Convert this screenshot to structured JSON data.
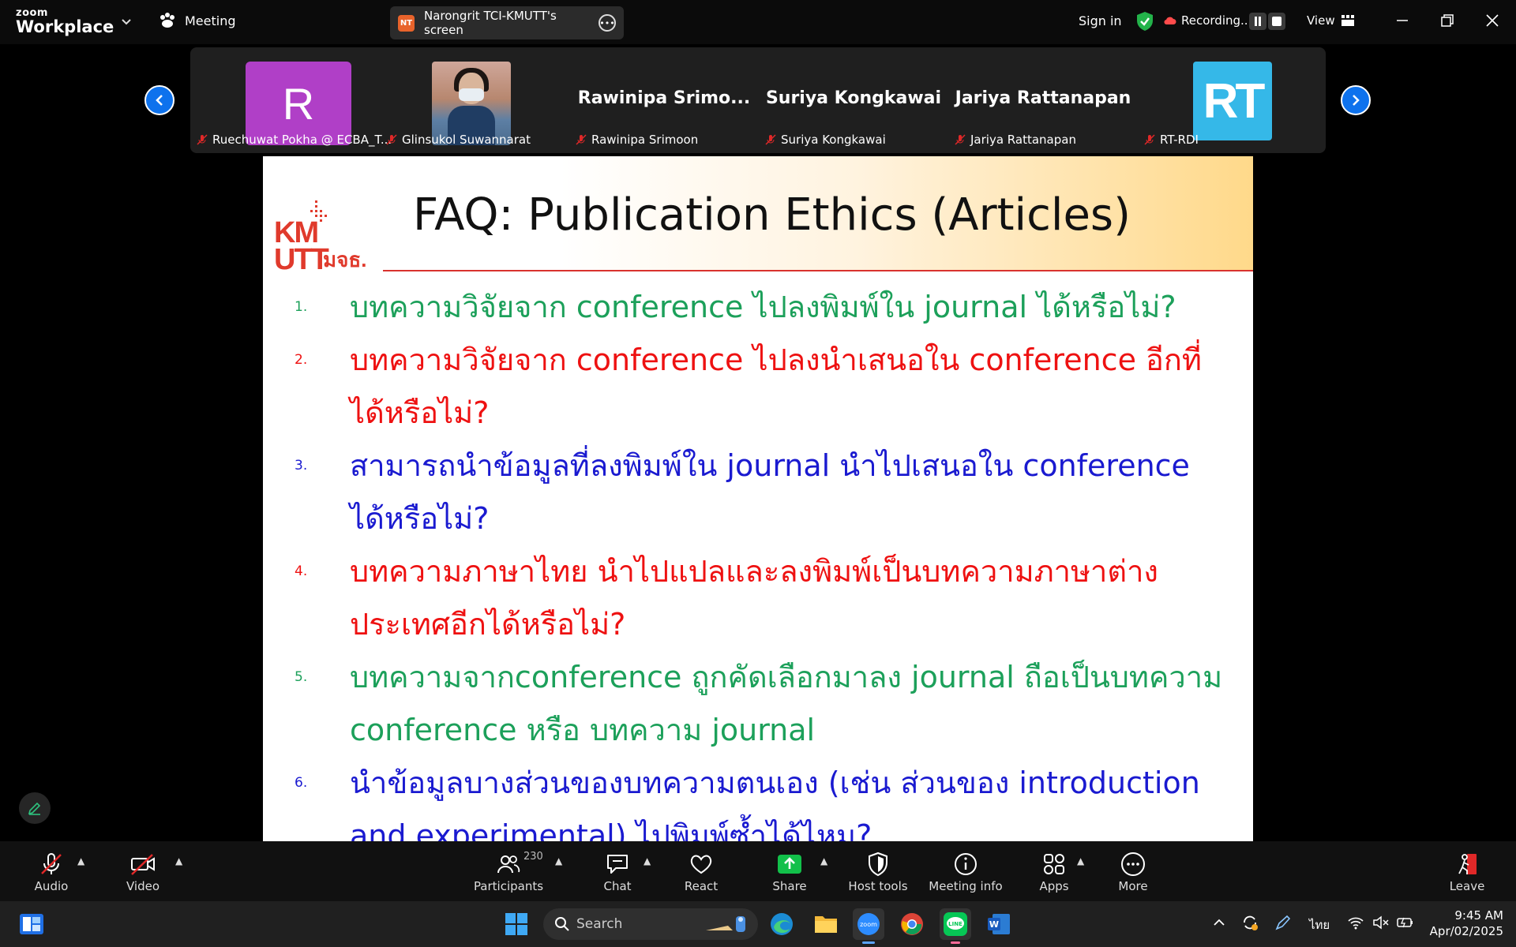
{
  "app": {
    "brand_small": "zoom",
    "brand_large": "Workplace"
  },
  "topbar": {
    "meeting_label": "Meeting",
    "screen_badge": "NT",
    "screen_label": "Narongrit TCI-KMUTT's screen",
    "sign_in": "Sign in",
    "recording": "Recording...",
    "view": "View"
  },
  "participants": [
    {
      "name": "Ruechuwat Pokha @ ECBA_T...",
      "avatar_letter": "R",
      "muted": true
    },
    {
      "name": "Glinsukol Suwannarat",
      "avatar": "photo",
      "muted": true
    },
    {
      "name": "Rawinipa Srimoon",
      "display_name": "Rawinipa  Srimo...",
      "muted": true
    },
    {
      "name": "Suriya Kongkawai",
      "display_name": "Suriya Kongkawai",
      "muted": true
    },
    {
      "name": "Jariya Rattanapan",
      "display_name": "Jariya Rattanapan",
      "muted": true
    },
    {
      "name": "RT-RDI",
      "avatar_text": "RT",
      "muted": true
    }
  ],
  "slide": {
    "title": "FAQ: Publication Ethics (Articles)",
    "logo_main": "KMUTT",
    "logo_thai": "มจธ.",
    "items": [
      {
        "num": "1.",
        "text": "บทความวิจัยจาก conference ไปลงพิมพ์ใน journal ได้หรือไม่?",
        "color": "#1ca05a"
      },
      {
        "num": "2.",
        "text": "บทความวิจัยจาก conference ไปลงนำเสนอใน conference อีกที่ได้หรือไม่?",
        "color": "#ee1111"
      },
      {
        "num": "3.",
        "text": "สามารถนำข้อมูลที่ลงพิมพ์ใน journal นำไปเสนอใน conference ได้หรือไม่?",
        "color": "#1a1ad0"
      },
      {
        "num": "4.",
        "text": "บทความภาษาไทย นำไปแปลและลงพิมพ์เป็นบทความภาษาต่างประเทศอีกได้หรือไม่?",
        "color": "#ee1111"
      },
      {
        "num": "5.",
        "text": "บทความจากconference ถูกคัดเลือกมาลง journal ถือเป็นบทความ conference หรือ บทความ journal",
        "color": "#1ca05a"
      },
      {
        "num": "6.",
        "text": "นำข้อมูลบางส่วนของบทความตนเอง (เช่น ส่วนของ introduction and experimental) ไปพิมพ์ซ้ำได้ไหม?",
        "color": "#1a1ad0"
      }
    ]
  },
  "toolbar": {
    "audio": "Audio",
    "video": "Video",
    "participants": "Participants",
    "participant_count": "230",
    "chat": "Chat",
    "react": "React",
    "share": "Share",
    "host_tools": "Host tools",
    "meeting_info": "Meeting info",
    "apps": "Apps",
    "more": "More",
    "leave": "Leave"
  },
  "taskbar": {
    "search_placeholder": "Search",
    "language": "ไทย",
    "time": "9:45 AM",
    "date": "Apr/02/2025"
  },
  "colors": {
    "accent": "#0e72ed",
    "share_green": "#12c04a",
    "danger": "#e02828"
  }
}
